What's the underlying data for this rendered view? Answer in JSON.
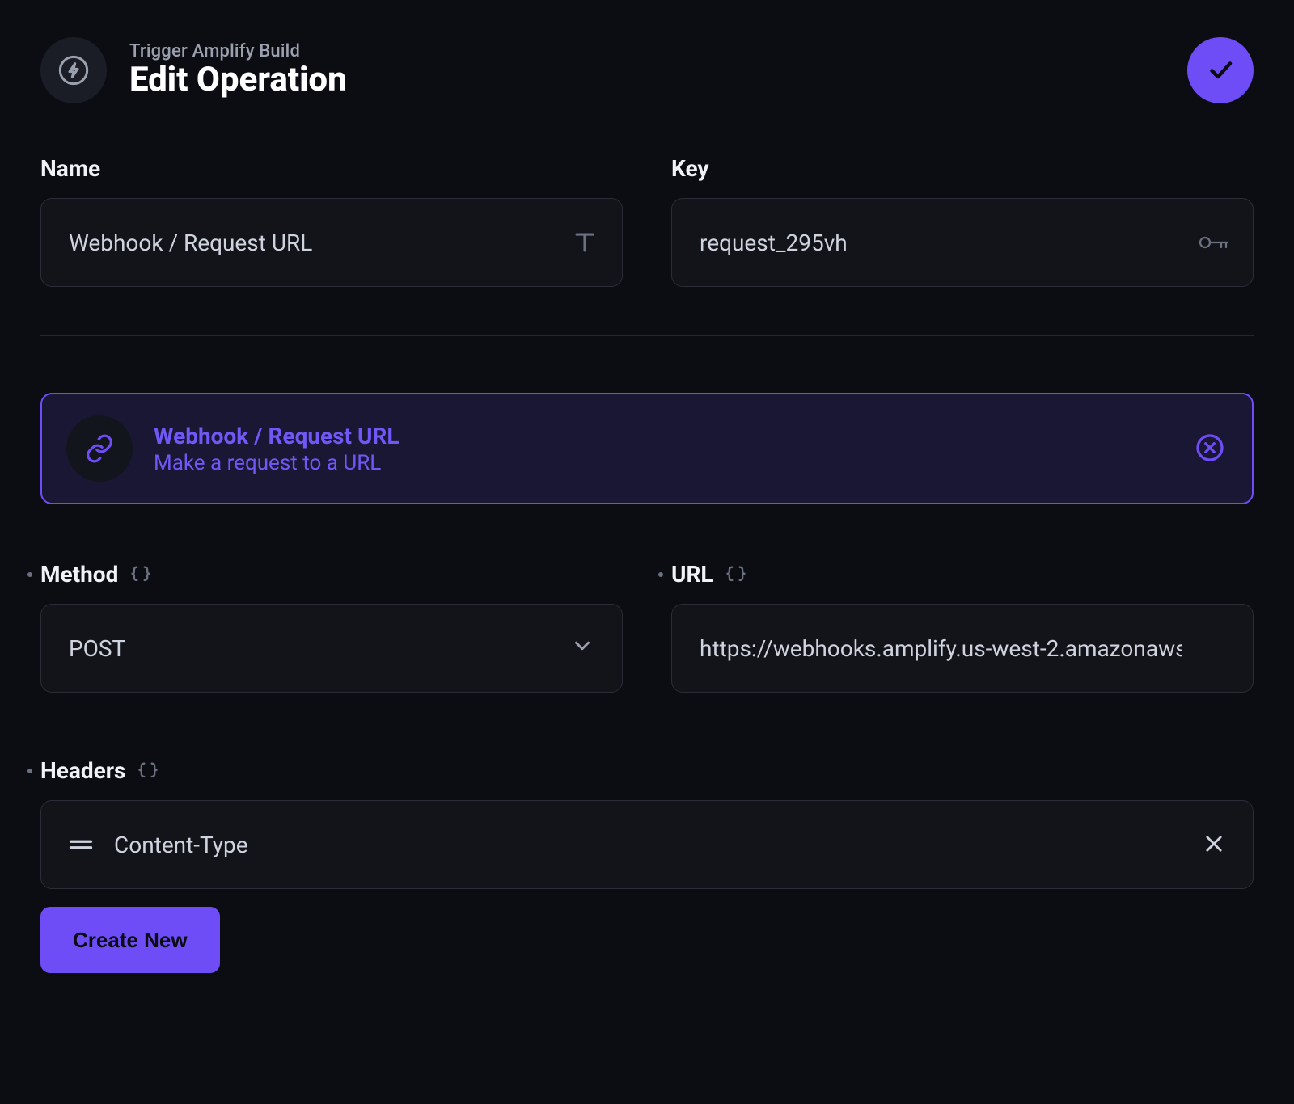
{
  "header": {
    "subtitle": "Trigger Amplify Build",
    "title": "Edit Operation"
  },
  "fields": {
    "name": {
      "label": "Name",
      "value": "Webhook / Request URL"
    },
    "key": {
      "label": "Key",
      "value": "request_295vh"
    },
    "method": {
      "label": "Method",
      "value": "POST"
    },
    "url": {
      "label": "URL",
      "value": "https://webhooks.amplify.us-west-2.amazonaws"
    },
    "headers": {
      "label": "Headers",
      "items": [
        {
          "name": "Content-Type"
        }
      ],
      "create_label": "Create New"
    }
  },
  "callout": {
    "title": "Webhook / Request URL",
    "subtitle": "Make a request to a URL"
  }
}
